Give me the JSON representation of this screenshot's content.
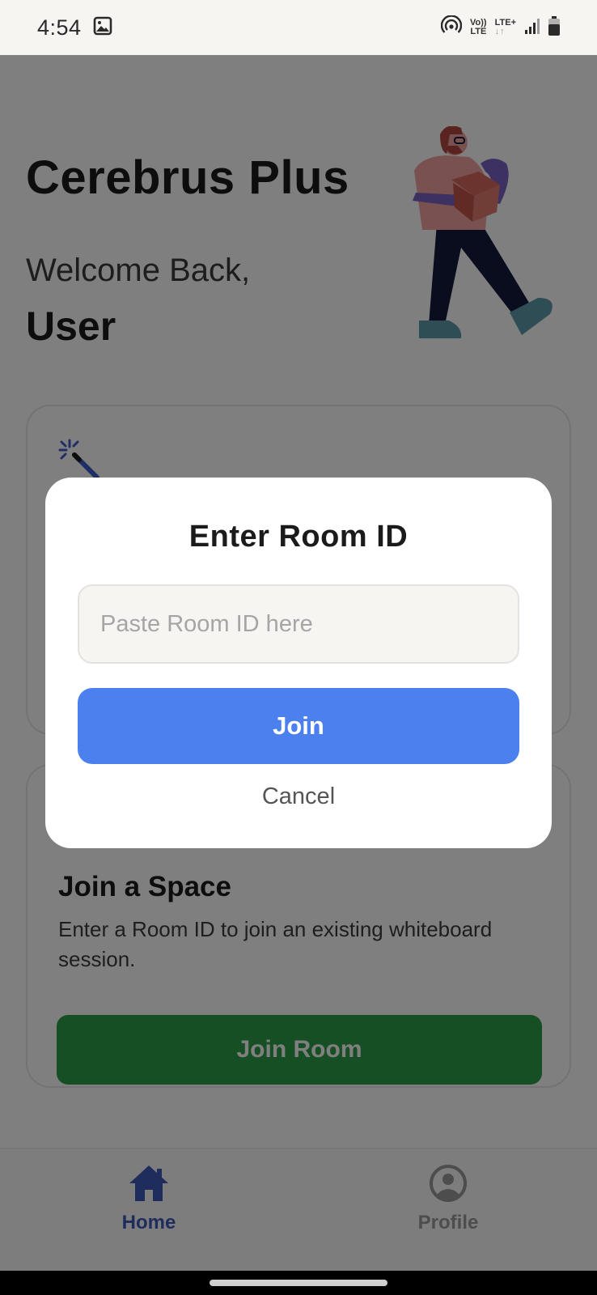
{
  "status_bar": {
    "time": "4:54",
    "network_top": "Vo))",
    "network_bottom": "LTE",
    "lte_plus": "LTE+",
    "data_arrows": "↓↑",
    "icons": [
      "image-icon",
      "hotspot-icon",
      "signal-icon",
      "battery-icon"
    ]
  },
  "app": {
    "title": "Cerebrus Plus",
    "welcome": "Welcome Back,",
    "username": "User"
  },
  "cards": {
    "join_space": {
      "heading": "Join a Space",
      "description": "Enter a Room ID to join an existing whiteboard session.",
      "button_label": "Join Room",
      "button_color": "#2e9e48"
    }
  },
  "bottom_nav": {
    "items": [
      {
        "label": "Home",
        "icon": "home-icon",
        "active": true
      },
      {
        "label": "Profile",
        "icon": "profile-icon",
        "active": false
      }
    ],
    "active_color": "#3d5ab8"
  },
  "dialog": {
    "title": "Enter Room ID",
    "input_placeholder": "Paste Room ID here",
    "input_value": "",
    "join_label": "Join",
    "join_color": "#4b80ee",
    "cancel_label": "Cancel"
  }
}
